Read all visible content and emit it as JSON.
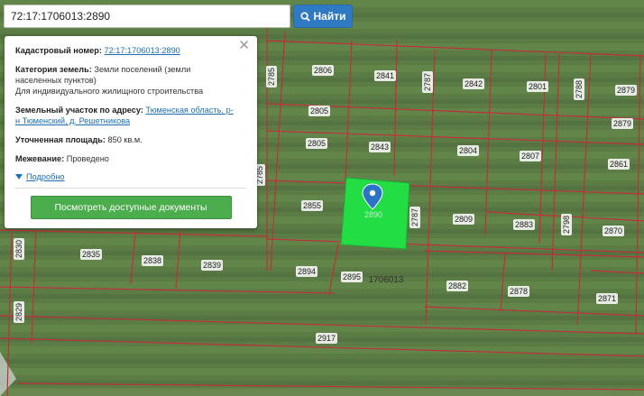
{
  "search": {
    "query": "72:17:1706013:2890",
    "button_label": "Найти",
    "icon": "search-icon"
  },
  "popup": {
    "close_icon": "close-icon",
    "cadastral_label": "Кадастровый номер:",
    "cadastral_value": "72:17:1706013:2890",
    "category_label": "Категория земель:",
    "category_value_1": "Земли поселений (земли",
    "category_value_2": "населенных пунктов)",
    "usage_value": "Для индивидуального жилищного строительства",
    "address_label": "Земельный участок по адресу:",
    "address_link_1": "Тюменская область, р-",
    "address_link_2": "н Тюменский, д. Решетникова",
    "area_label": "Уточненная площадь:",
    "area_value": "850 кв.м.",
    "survey_label": "Межевание:",
    "survey_value": "Проведено",
    "details_label": "Подробно",
    "docs_button": "Посмотреть доступные документы"
  },
  "map": {
    "selected_color": "#22dd44",
    "boundary_color": "#c0303a",
    "quarter_label": "1706013",
    "marker_label": "2890",
    "plots": [
      "2806",
      "2841",
      "2842",
      "2801",
      "2879",
      "2785",
      "2787",
      "2788",
      "2805",
      "2879",
      "2805",
      "2843",
      "2804",
      "2807",
      "2861",
      "2785",
      "2855",
      "2787",
      "2809",
      "2883",
      "2798",
      "2870",
      "2835",
      "2838",
      "2839",
      "2830",
      "2894",
      "2895",
      "2882",
      "2878",
      "2871",
      "2829",
      "2917"
    ]
  }
}
